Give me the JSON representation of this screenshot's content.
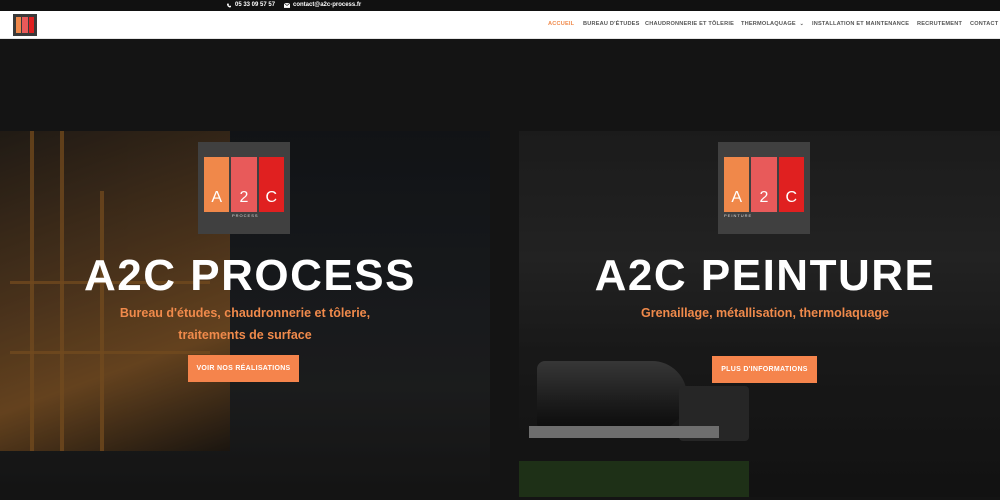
{
  "topbar": {
    "phone": "05 33 09 57 57",
    "email": "contact@a2c-process.fr",
    "phone_icon": "phone-icon",
    "email_icon": "envelope-icon"
  },
  "nav": {
    "items": [
      {
        "label": "ACCUEIL",
        "active": true
      },
      {
        "label": "BUREAU D'ÉTUDES",
        "active": false
      },
      {
        "label": "CHAUDRONNERIE ET TÔLERIE",
        "active": false
      },
      {
        "label": "THERMOLAQUAGE",
        "active": false,
        "has_dropdown": true
      },
      {
        "label": "INSTALLATION ET MAINTENANCE",
        "active": false
      },
      {
        "label": "RECRUTEMENT",
        "active": false
      },
      {
        "label": "CONTACT",
        "active": false
      }
    ]
  },
  "left": {
    "logo_letters": [
      "A",
      "2",
      "C"
    ],
    "logo_sub": "PROCESS",
    "title": "A2C PROCESS",
    "subtitle_line1": "Bureau d'études, chaudronnerie et tôlerie,",
    "subtitle_line2": "traitements de surface",
    "button": "VOIR NOS RÉALISATIONS"
  },
  "right": {
    "logo_letters": [
      "A",
      "2",
      "C"
    ],
    "logo_sub": "PEINTURE",
    "title": "A2C PEINTURE",
    "subtitle": "Grenaillage, métallisation, thermolaquage",
    "button": "PLUS D'INFORMATIONS"
  },
  "colors": {
    "accent": "#f08a4b",
    "button": "#f5844c",
    "bar1": "#f0884a",
    "bar2": "#e85a5a",
    "bar3": "#e02020"
  }
}
